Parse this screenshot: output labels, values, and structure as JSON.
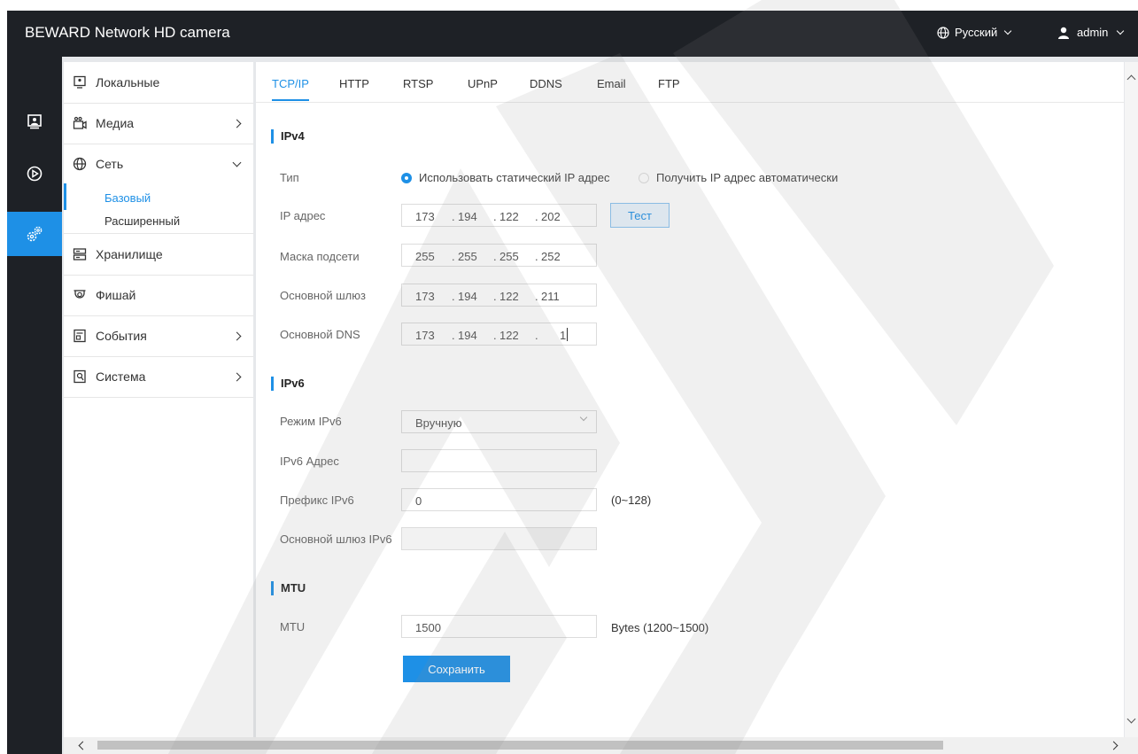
{
  "header": {
    "title": "BEWARD Network HD camera",
    "language": "Русский",
    "user": "admin"
  },
  "rail": {
    "items": [
      {
        "name": "live-view",
        "icon": "monitor-icon"
      },
      {
        "name": "playback",
        "icon": "play-circle-icon"
      },
      {
        "name": "settings",
        "icon": "gears-icon",
        "active": true
      }
    ]
  },
  "sidebar": {
    "items": [
      {
        "label": "Локальные",
        "icon": "monitor-local-icon"
      },
      {
        "label": "Медиа",
        "icon": "camera-icon"
      },
      {
        "label": "Сеть",
        "icon": "globe-icon"
      },
      {
        "label": "Хранилище",
        "icon": "storage-icon"
      },
      {
        "label": "Фишай",
        "icon": "fisheye-icon"
      },
      {
        "label": "События",
        "icon": "events-icon"
      },
      {
        "label": "Система",
        "icon": "system-icon"
      }
    ],
    "network_sub": [
      "Базовый",
      "Расширенный"
    ]
  },
  "tabs": [
    "TCP/IP",
    "HTTP",
    "RTSP",
    "UPnP",
    "DDNS",
    "Email",
    "FTP"
  ],
  "ipv4": {
    "section": "IPv4",
    "type_label": "Тип",
    "radio_static": "Использовать статический IP адрес",
    "radio_dhcp": "Получить IP адрес автоматически",
    "ip_label": "IP адрес",
    "ip": [
      "173",
      "194",
      "122",
      "202"
    ],
    "test_button": "Тест",
    "mask_label": "Маска подсети",
    "mask": [
      "255",
      "255",
      "255",
      "252"
    ],
    "gateway_label": "Основной шлюз",
    "gateway": [
      "173",
      "194",
      "122",
      "211"
    ],
    "dns_label": "Основной DNS",
    "dns": [
      "173",
      "194",
      "122",
      "1"
    ]
  },
  "ipv6": {
    "section": "IPv6",
    "mode_label": "Режим IPv6",
    "mode_value": "Вручную",
    "address_label": "IPv6 Адрес",
    "address_value": "",
    "prefix_label": "Префикс IPv6",
    "prefix_value": "0",
    "prefix_hint": "(0~128)",
    "gateway_label": "Основной шлюз IPv6",
    "gateway_value": ""
  },
  "mtu": {
    "section": "MTU",
    "label": "MTU",
    "value": "1500",
    "hint": "Bytes (1200~1500)"
  },
  "save_button": "Сохранить",
  "colors": {
    "accent": "#1e90e6",
    "topbar": "#1e2126"
  }
}
